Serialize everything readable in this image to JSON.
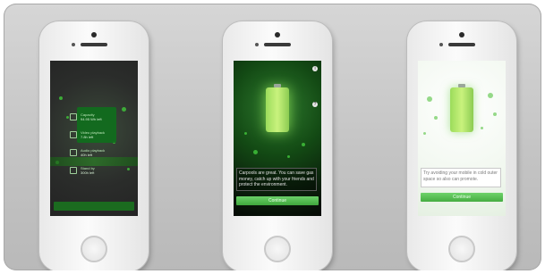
{
  "phones": [
    {
      "screen": "stats",
      "rows": [
        {
          "title": "Capacity",
          "value": "94.95 Wh left",
          "icon": "battery-icon"
        },
        {
          "title": "Video playback",
          "value": "7.8h left",
          "icon": "video-icon"
        },
        {
          "title": "Audio playback",
          "value": "40h left",
          "icon": "music-icon"
        },
        {
          "title": "Stand by",
          "value": "300h left",
          "icon": "standby-icon"
        }
      ]
    },
    {
      "screen": "message-dark",
      "message": "Carpools are great. You can save gas money, catch up with your friends and protect the environment.",
      "button_label": "Continue",
      "top_icon": "info-icon",
      "side_icon": "tip-icon"
    },
    {
      "screen": "message-light",
      "message": "Try avoiding your mobile in cold outer space so also can promote.",
      "button_label": "Continue"
    }
  ]
}
